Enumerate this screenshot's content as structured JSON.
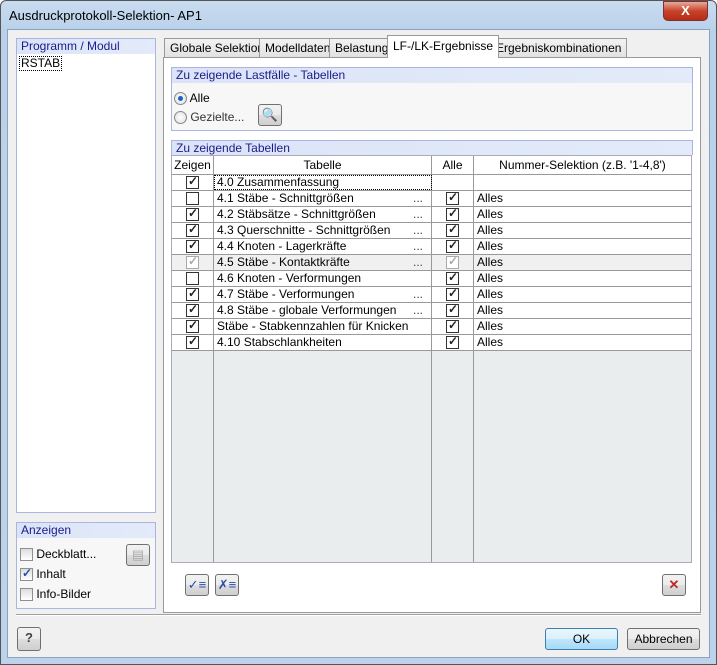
{
  "window": {
    "title": "Ausdruckprotokoll-Selektion- AP1",
    "close_label": "X"
  },
  "left": {
    "group_title": "Programm / Modul",
    "items": [
      "RSTAB"
    ]
  },
  "anzeigen": {
    "title": "Anzeigen",
    "items": [
      {
        "label": "Deckblatt...",
        "checked": false
      },
      {
        "label": "Inhalt",
        "checked": true
      },
      {
        "label": "Info-Bilder",
        "checked": false
      }
    ]
  },
  "tabs": [
    {
      "label": "Globale Selektion"
    },
    {
      "label": "Modelldaten"
    },
    {
      "label": "Belastung"
    },
    {
      "label": "LF-/LK-Ergebnisse",
      "active": true
    },
    {
      "label": "Ergebniskombinationen"
    }
  ],
  "lastfaelle": {
    "title": "Zu zeigende Lastfälle - Tabellen",
    "options": [
      {
        "label": "Alle",
        "selected": true
      },
      {
        "label": "Gezielte...",
        "selected": false
      }
    ]
  },
  "tabellen": {
    "title": "Zu zeigende Tabellen",
    "columns": [
      "Zeigen",
      "Tabelle",
      "Alle",
      "Nummer-Selektion (z.B. '1-4,8')"
    ],
    "rows": [
      {
        "zeigen": true,
        "name": "4.0 Zusammenfassung",
        "dots": "",
        "alle": null,
        "selection": ""
      },
      {
        "zeigen": false,
        "name": "4.1 Stäbe - Schnittgrößen",
        "dots": "...",
        "alle": true,
        "selection": "Alles"
      },
      {
        "zeigen": true,
        "name": "4.2 Stäbsätze - Schnittgrößen",
        "dots": "...",
        "alle": true,
        "selection": "Alles"
      },
      {
        "zeigen": true,
        "name": "4.3 Querschnitte - Schnittgrößen",
        "dots": "...",
        "alle": true,
        "selection": "Alles"
      },
      {
        "zeigen": true,
        "name": "4.4 Knoten - Lagerkräfte",
        "dots": "...",
        "alle": true,
        "selection": "Alles"
      },
      {
        "zeigen": true,
        "name": "4.5 Stäbe - Kontaktkräfte",
        "dots": "...",
        "alle": true,
        "selection": "Alles",
        "disabled": true
      },
      {
        "zeigen": false,
        "name": "4.6 Knoten - Verformungen",
        "dots": "",
        "alle": true,
        "selection": "Alles"
      },
      {
        "zeigen": true,
        "name": "4.7 Stäbe - Verformungen",
        "dots": "...",
        "alle": true,
        "selection": "Alles"
      },
      {
        "zeigen": true,
        "name": "4.8 Stäbe - globale Verformungen",
        "dots": "...",
        "alle": true,
        "selection": "Alles"
      },
      {
        "zeigen": true,
        "name": "Stäbe - Stabkennzahlen für Knicken",
        "dots": "",
        "alle": true,
        "selection": "Alles"
      },
      {
        "zeigen": true,
        "name": "4.10 Stabschlankheiten",
        "dots": "",
        "alle": true,
        "selection": "Alles"
      }
    ]
  },
  "footer": {
    "ok": "OK",
    "cancel": "Abbrechen"
  }
}
